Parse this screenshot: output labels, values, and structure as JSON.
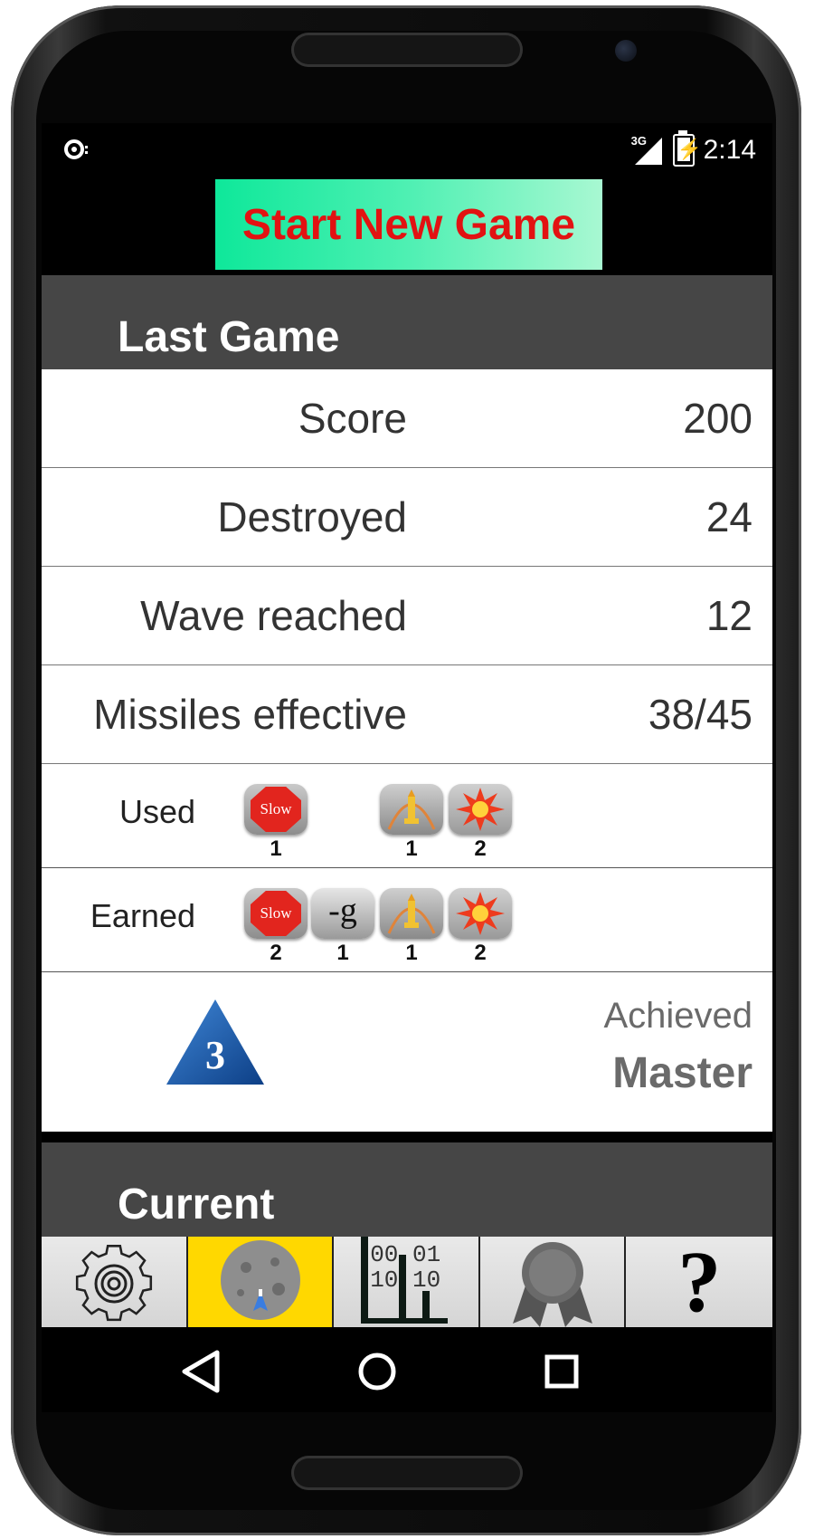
{
  "status_bar": {
    "time": "2:14",
    "network": "3G",
    "notification_icon": "sync-icon",
    "battery_icon": "battery-charging-icon"
  },
  "start_button": {
    "label": "Start New Game"
  },
  "last_game": {
    "header": "Last Game",
    "stats": [
      {
        "label": "Score",
        "value": "200"
      },
      {
        "label": "Destroyed",
        "value": "24"
      },
      {
        "label": "Wave reached",
        "value": "12"
      },
      {
        "label": "Missiles effective",
        "value": "38/45"
      }
    ],
    "used": {
      "label": "Used",
      "items": [
        {
          "icon": "slow-powerup-icon",
          "text": "Slow",
          "count": "1"
        },
        {
          "icon": "rocket-powerup-icon",
          "count": "1"
        },
        {
          "icon": "explosion-powerup-icon",
          "count": "2"
        }
      ]
    },
    "earned": {
      "label": "Earned",
      "items": [
        {
          "icon": "slow-powerup-icon",
          "text": "Slow",
          "count": "2"
        },
        {
          "icon": "negative-gravity-powerup-icon",
          "text": "-g",
          "count": "1"
        },
        {
          "icon": "rocket-powerup-icon",
          "count": "1"
        },
        {
          "icon": "explosion-powerup-icon",
          "count": "2"
        }
      ]
    },
    "achievement": {
      "rank_number": "3",
      "label": "Achieved",
      "value": "Master"
    }
  },
  "current": {
    "header": "Current"
  },
  "tabs": [
    {
      "icon": "gear-icon",
      "active": false
    },
    {
      "icon": "game-planet-icon",
      "active": true
    },
    {
      "icon": "stats-chart-icon",
      "text_top": "00 01",
      "text_bottom": "10 10",
      "active": false
    },
    {
      "icon": "award-ribbon-icon",
      "active": false
    },
    {
      "icon": "help-icon",
      "text": "?",
      "active": false
    }
  ],
  "colors": {
    "start_button_text": "#e21212",
    "start_button_gradient": [
      "#0ee89a",
      "#a8f8d2"
    ],
    "section_header_bg": "#464646",
    "active_tab": "#ffd800",
    "rank_triangle": "#1b5aa8"
  },
  "navigation": {
    "back_icon": "back-triangle-icon",
    "home_icon": "home-circle-icon",
    "recents_icon": "recents-square-icon"
  }
}
